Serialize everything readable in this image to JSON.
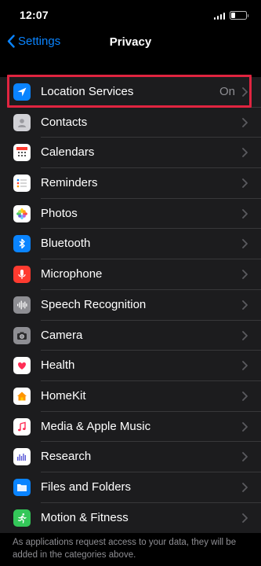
{
  "status": {
    "time": "12:07",
    "battery_level": 0.3
  },
  "nav": {
    "back_label": "Settings",
    "title": "Privacy"
  },
  "items": [
    {
      "label": "Location Services",
      "value": "On",
      "icon": "location-arrow-icon",
      "color": "#0a84ff"
    },
    {
      "label": "Contacts",
      "value": "",
      "icon": "contacts-icon",
      "color": "#d1d1d6"
    },
    {
      "label": "Calendars",
      "value": "",
      "icon": "calendar-icon",
      "color": "#ffffff"
    },
    {
      "label": "Reminders",
      "value": "",
      "icon": "reminders-icon",
      "color": "#ffffff"
    },
    {
      "label": "Photos",
      "value": "",
      "icon": "photos-icon",
      "color": "#ffffff"
    },
    {
      "label": "Bluetooth",
      "value": "",
      "icon": "bluetooth-icon",
      "color": "#0a84ff"
    },
    {
      "label": "Microphone",
      "value": "",
      "icon": "microphone-icon",
      "color": "#ff3b30"
    },
    {
      "label": "Speech Recognition",
      "value": "",
      "icon": "waveform-icon",
      "color": "#8e8e93"
    },
    {
      "label": "Camera",
      "value": "",
      "icon": "camera-icon",
      "color": "#8e8e93"
    },
    {
      "label": "Health",
      "value": "",
      "icon": "heart-icon",
      "color": "#ffffff"
    },
    {
      "label": "HomeKit",
      "value": "",
      "icon": "home-icon",
      "color": "#ffffff"
    },
    {
      "label": "Media & Apple Music",
      "value": "",
      "icon": "music-note-icon",
      "color": "#ffffff"
    },
    {
      "label": "Research",
      "value": "",
      "icon": "research-icon",
      "color": "#ffffff"
    },
    {
      "label": "Files and Folders",
      "value": "",
      "icon": "folder-icon",
      "color": "#0a84ff"
    },
    {
      "label": "Motion & Fitness",
      "value": "",
      "icon": "running-figure-icon",
      "color": "#34c759"
    }
  ],
  "footer": {
    "text": "As applications request access to your data, they will be added in the categories above."
  },
  "accent": "#0a84ff",
  "highlight_color": "#e02440"
}
